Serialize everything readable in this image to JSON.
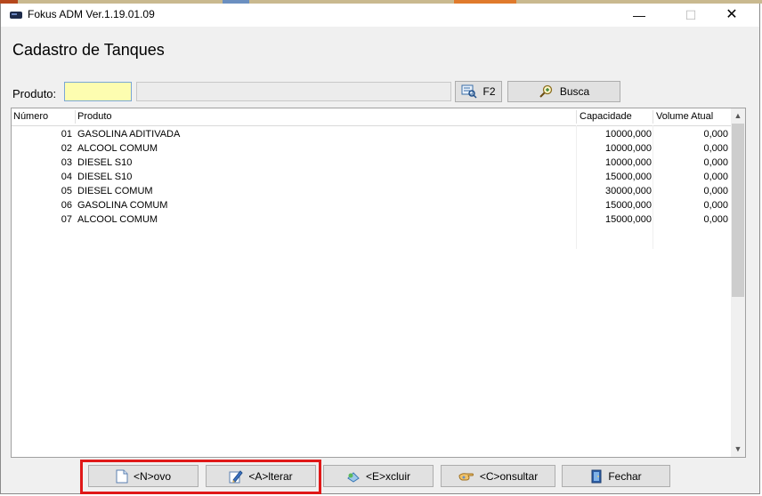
{
  "window": {
    "title": "Fokus ADM Ver.1.19.01.09",
    "minimize_glyph": "—",
    "maximize_glyph": "☐",
    "close_glyph": "✕"
  },
  "form": {
    "heading": "Cadastro de Tanques",
    "produto_label": "Produto:",
    "produto_value": "",
    "produto_desc": "",
    "f2_label": "F2",
    "busca_label": "Busca"
  },
  "grid": {
    "columns": [
      "Número",
      "Produto",
      "Capacidade",
      "Volume Atual"
    ],
    "rows": [
      {
        "numero": "01",
        "produto": "GASOLINA ADITIVADA",
        "capacidade": "10000,000",
        "volume": "0,000"
      },
      {
        "numero": "02",
        "produto": "ALCOOL COMUM",
        "capacidade": "10000,000",
        "volume": "0,000"
      },
      {
        "numero": "03",
        "produto": "DIESEL S10",
        "capacidade": "10000,000",
        "volume": "0,000"
      },
      {
        "numero": "04",
        "produto": "DIESEL S10",
        "capacidade": "15000,000",
        "volume": "0,000"
      },
      {
        "numero": "05",
        "produto": "DIESEL COMUM",
        "capacidade": "30000,000",
        "volume": "0,000"
      },
      {
        "numero": "06",
        "produto": "GASOLINA COMUM",
        "capacidade": "15000,000",
        "volume": "0,000"
      },
      {
        "numero": "07",
        "produto": "ALCOOL COMUM",
        "capacidade": "15000,000",
        "volume": "0,000"
      }
    ]
  },
  "buttons": {
    "novo": "<N>ovo",
    "alterar": "<A>lterar",
    "excluir": "<E>xcluir",
    "consultar": "<C>onsultar",
    "fechar": "Fechar"
  },
  "icons": {
    "app": "monitor-icon",
    "f2": "search-list-icon",
    "busca": "magnifier-plus-icon",
    "novo": "new-document-icon",
    "alterar": "pencil-edit-icon",
    "excluir": "delete-icon",
    "consultar": "hand-pointer-icon",
    "fechar": "door-exit-icon"
  },
  "colors": {
    "input_highlight": "#fdfdb0",
    "annotation_box": "#e01818"
  }
}
